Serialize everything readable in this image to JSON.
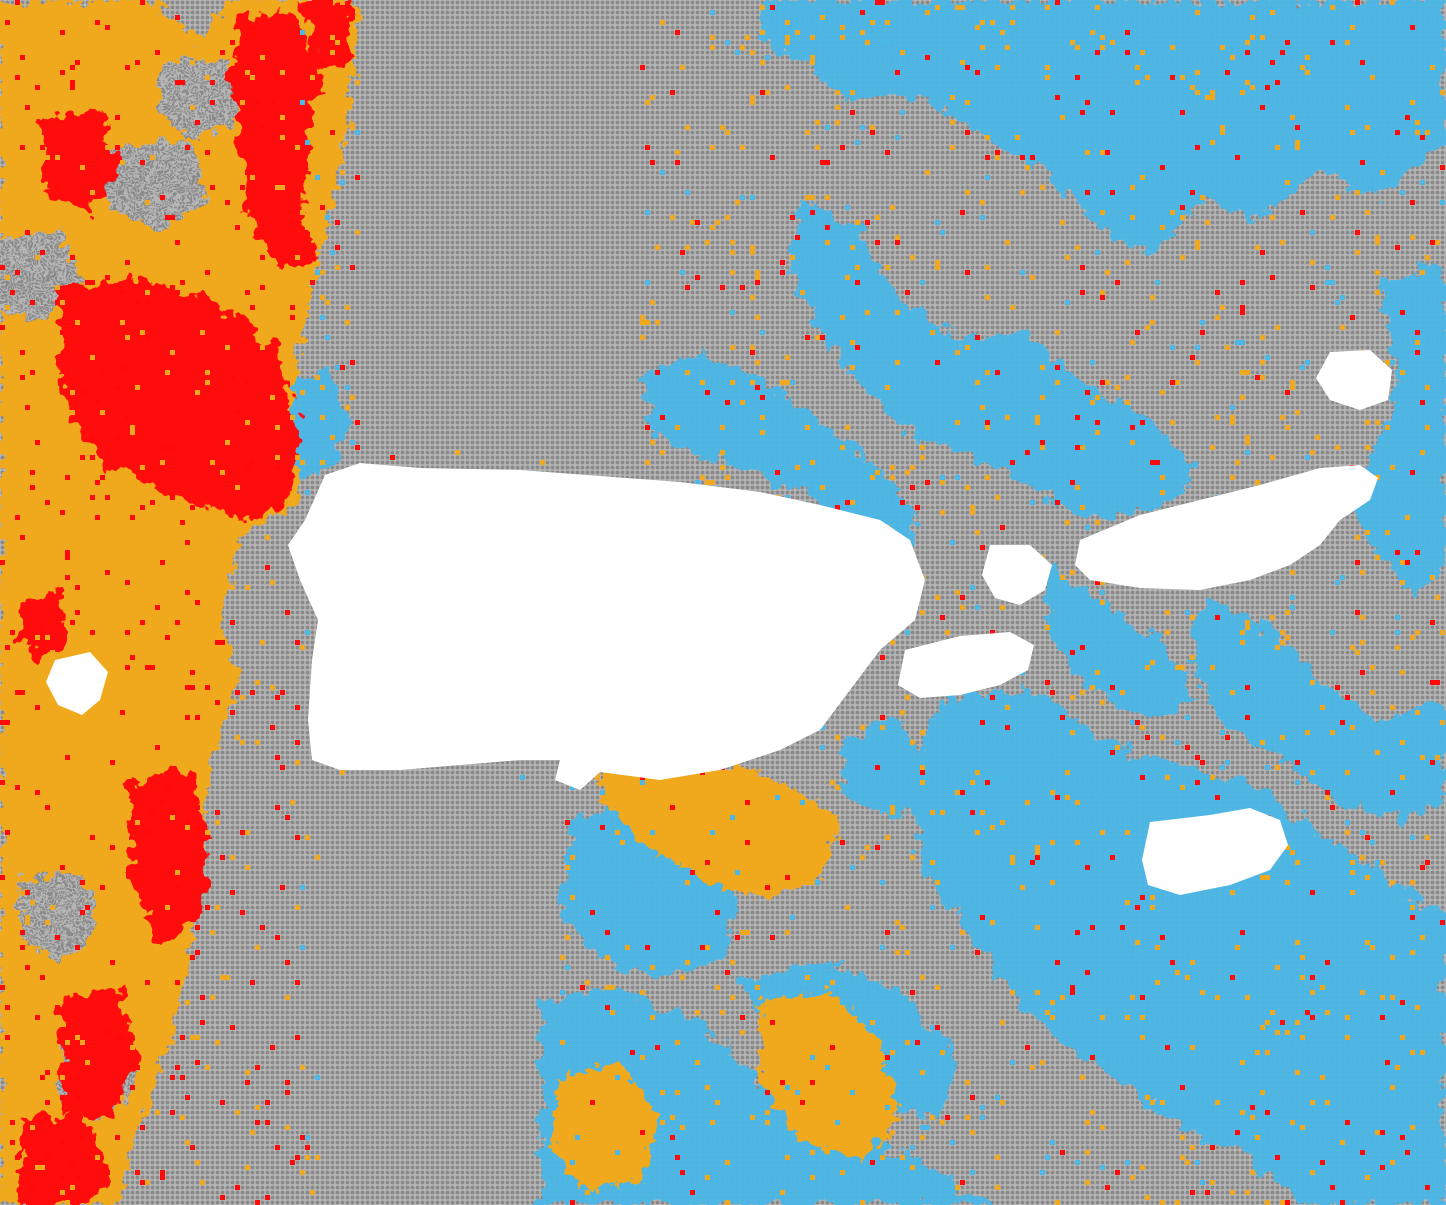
{
  "map": {
    "type": "dot-grid classification map",
    "colors": {
      "background_grid": "#8a8a8a",
      "land_mask": "#ffffff",
      "class_blue": "#4cb8e8",
      "class_orange": "#f0a81e",
      "class_red": "#ff0a0a"
    },
    "legend": [],
    "title": ""
  }
}
